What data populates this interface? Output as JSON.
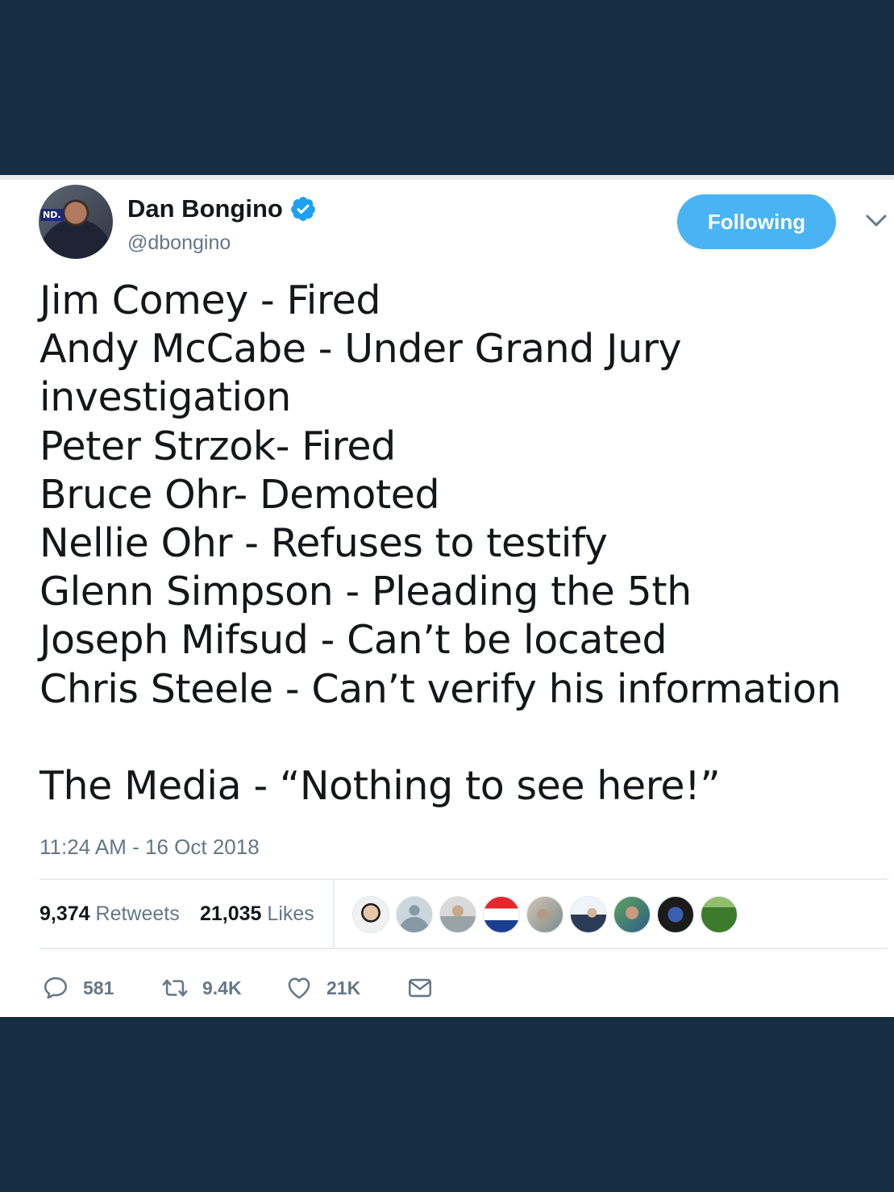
{
  "tweet": {
    "author": {
      "display_name": "Dan Bongino",
      "handle": "@dbongino",
      "avatar_tag": "ND."
    },
    "follow_button_label": "Following",
    "text": "Jim Comey - Fired\nAndy McCabe - Under Grand Jury investigation\nPeter Strzok- Fired\nBruce Ohr- Demoted\nNellie Ohr - Refuses to testify\nGlenn Simpson - Pleading the 5th\nJoseph Mifsud - Can’t be located\nChris Steele - Can’t verify his information\n\nThe Media - “Nothing to see here!”",
    "timestamp": "11:24 AM - 16 Oct 2018",
    "stats": {
      "retweets_count": "9,374",
      "retweets_label": "Retweets",
      "likes_count": "21,035",
      "likes_label": "Likes"
    },
    "actions": {
      "replies": "581",
      "retweets": "9.4K",
      "likes": "21K"
    }
  },
  "icons": {
    "verified": "verified-badge-icon",
    "chevron": "chevron-down-icon",
    "reply": "reply-icon",
    "retweet": "retweet-icon",
    "like": "heart-icon",
    "message": "envelope-icon"
  },
  "colors": {
    "background": "#172d42",
    "accent": "#4ab3f4",
    "verified": "#1da1f2",
    "muted_text": "#657786"
  }
}
